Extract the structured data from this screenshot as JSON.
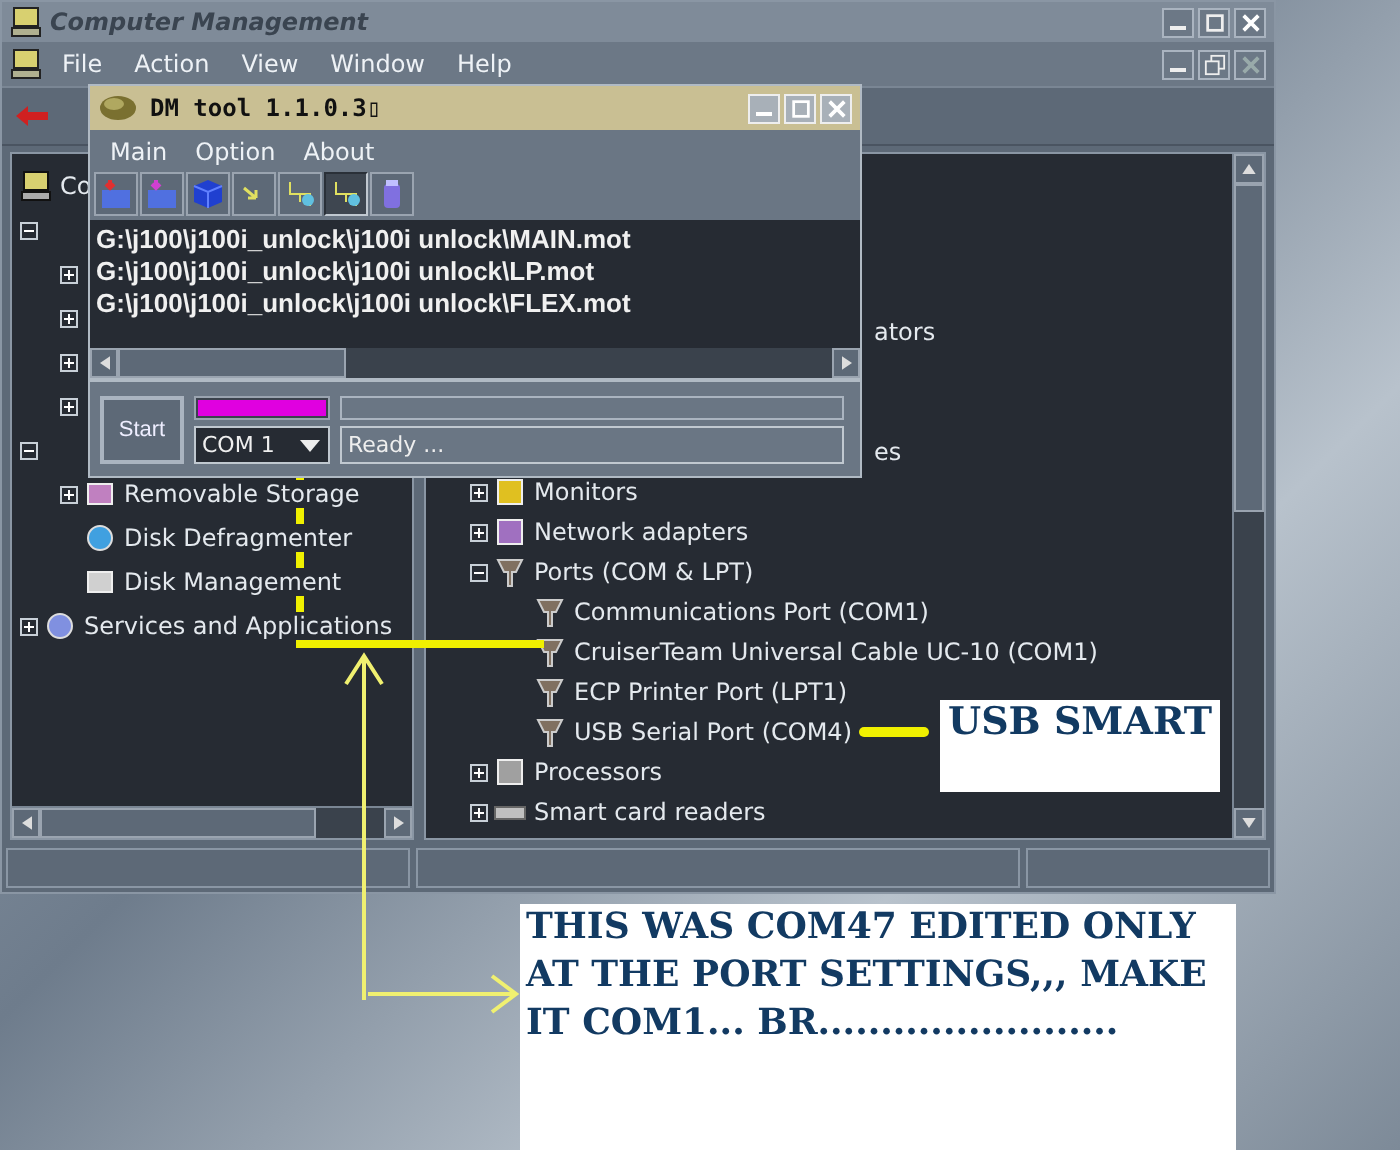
{
  "main_window": {
    "title": "Computer Management",
    "menu": [
      "File",
      "Action",
      "View",
      "Window",
      "Help"
    ],
    "left_tree": [
      {
        "label": "Co",
        "kind": "computer",
        "children": [
          {
            "expanded": true,
            "children": [
              {
                "expanded": false
              },
              {
                "expanded": false
              },
              {
                "expanded": false
              },
              {
                "expanded": false
              }
            ]
          },
          {
            "expanded": true,
            "children": [
              {
                "label": "Removable Storage",
                "kind": "storage",
                "expanded": false
              },
              {
                "label": "Disk Defragmenter",
                "kind": "defrag"
              },
              {
                "label": "Disk Management",
                "kind": "disk"
              }
            ]
          },
          {
            "label": "Services and Applications",
            "kind": "services",
            "expanded": false
          }
        ]
      }
    ],
    "right_tree": [
      {
        "label": "ators",
        "kind": "partial"
      },
      {
        "label": "es",
        "kind": "partial"
      },
      {
        "label": "Monitors",
        "kind": "monitor",
        "expanded": false
      },
      {
        "label": "Network adapters",
        "kind": "network",
        "expanded": false
      },
      {
        "label": "Ports (COM & LPT)",
        "kind": "port",
        "expanded": true,
        "children": [
          {
            "label": "Communications Port (COM1)",
            "kind": "port"
          },
          {
            "label": "CruiserTeam Universal Cable UC-10 (COM1)",
            "kind": "port"
          },
          {
            "label": "ECP Printer Port (LPT1)",
            "kind": "port"
          },
          {
            "label": "USB Serial Port (COM4)",
            "kind": "port"
          }
        ]
      },
      {
        "label": "Processors",
        "kind": "processor",
        "expanded": false
      },
      {
        "label": "Smart card readers",
        "kind": "reader",
        "expanded": false
      }
    ]
  },
  "dm_tool": {
    "title": "DM tool 1.1.0.3▯",
    "menu": [
      "Main",
      "Option",
      "About"
    ],
    "toolbar": [
      {
        "kind": "folder-down",
        "selected": false
      },
      {
        "kind": "folder-up",
        "selected": false
      },
      {
        "kind": "cube",
        "selected": false
      },
      {
        "kind": "arrow",
        "selected": false
      },
      {
        "kind": "network",
        "selected": false
      },
      {
        "kind": "network",
        "selected": true
      },
      {
        "kind": "jar",
        "selected": false
      }
    ],
    "files": [
      "G:\\j100\\j100i_unlock\\j100i unlock\\MAIN.mot",
      "G:\\j100\\j100i_unlock\\j100i unlock\\LP.mot",
      "G:\\j100\\j100i_unlock\\j100i unlock\\FLEX.mot"
    ],
    "start_button": "Start",
    "color_bar": {
      "level": 1
    },
    "port": "COM 1",
    "status": "Ready ..."
  },
  "annotations": {
    "usb_label": "USB SMART",
    "note": "THIS WAS COM47 EDITED ONLY AT THE PORT SETTINGS,,, MAKE IT COM1... BR........................"
  }
}
